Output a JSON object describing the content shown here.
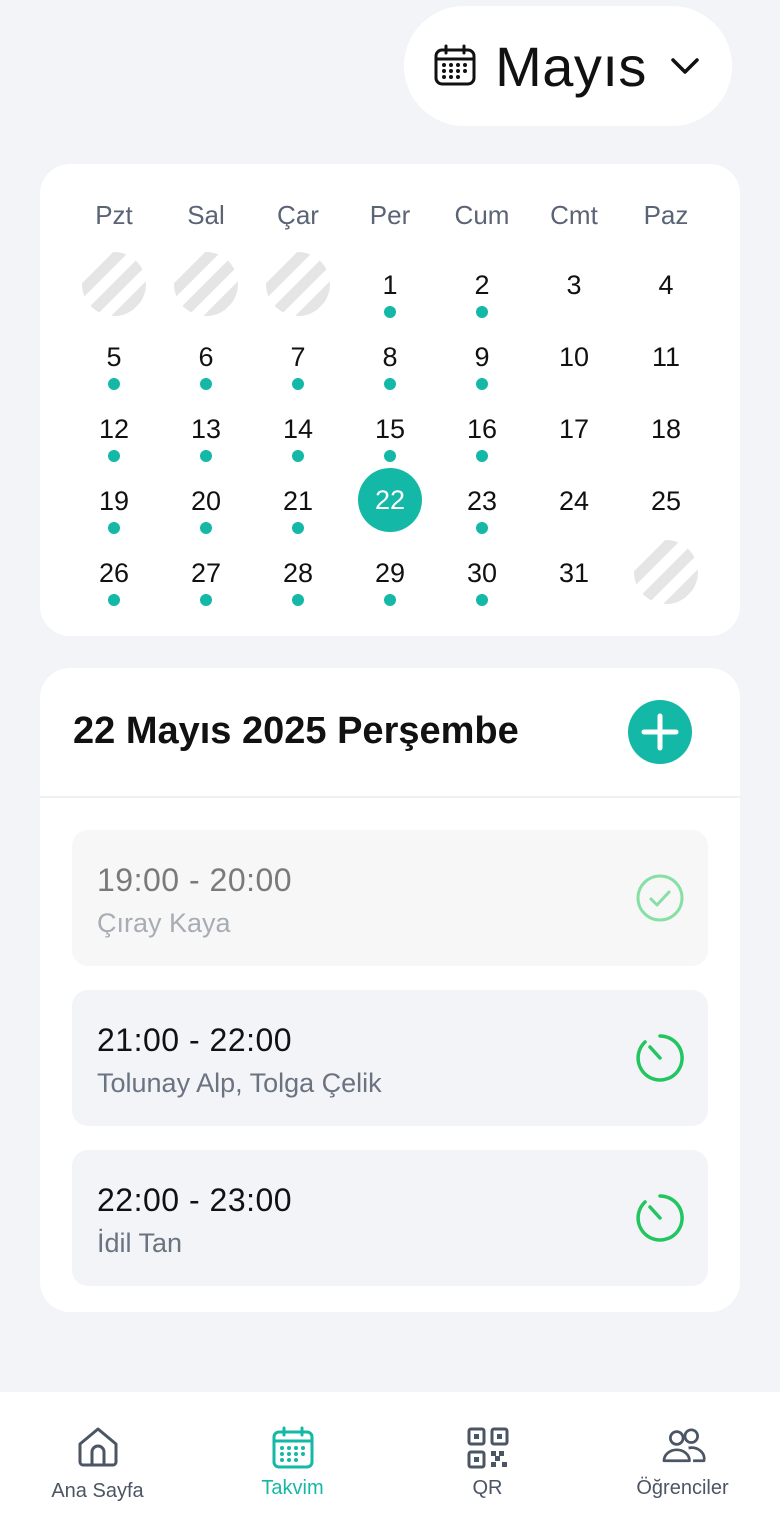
{
  "header": {
    "month": "Mayıs",
    "icon": "calendar-icon",
    "dropdown_icon": "chevron-down-icon"
  },
  "calendar": {
    "weekdays": [
      "Pzt",
      "Sal",
      "Çar",
      "Per",
      "Cum",
      "Cmt",
      "Paz"
    ],
    "weeks": [
      [
        null,
        null,
        null,
        {
          "day": "1",
          "dot": true
        },
        {
          "day": "2",
          "dot": true
        },
        {
          "day": "3",
          "dot": false
        },
        {
          "day": "4",
          "dot": false
        }
      ],
      [
        {
          "day": "5",
          "dot": true
        },
        {
          "day": "6",
          "dot": true
        },
        {
          "day": "7",
          "dot": true
        },
        {
          "day": "8",
          "dot": true
        },
        {
          "day": "9",
          "dot": true
        },
        {
          "day": "10",
          "dot": false
        },
        {
          "day": "11",
          "dot": false
        }
      ],
      [
        {
          "day": "12",
          "dot": true
        },
        {
          "day": "13",
          "dot": true
        },
        {
          "day": "14",
          "dot": true
        },
        {
          "day": "15",
          "dot": true
        },
        {
          "day": "16",
          "dot": true
        },
        {
          "day": "17",
          "dot": false
        },
        {
          "day": "18",
          "dot": false
        }
      ],
      [
        {
          "day": "19",
          "dot": true
        },
        {
          "day": "20",
          "dot": true
        },
        {
          "day": "21",
          "dot": true
        },
        {
          "day": "22",
          "dot": false,
          "selected": true
        },
        {
          "day": "23",
          "dot": true
        },
        {
          "day": "24",
          "dot": false
        },
        {
          "day": "25",
          "dot": false
        }
      ],
      [
        {
          "day": "26",
          "dot": true
        },
        {
          "day": "27",
          "dot": true
        },
        {
          "day": "28",
          "dot": true
        },
        {
          "day": "29",
          "dot": true
        },
        {
          "day": "30",
          "dot": true
        },
        {
          "day": "31",
          "dot": false
        },
        null
      ]
    ],
    "accent_color": "#14b8a6"
  },
  "day_detail": {
    "title": "22 Mayıs 2025 Perşembe",
    "add_icon": "plus-icon",
    "lessons": [
      {
        "time": "19:00 - 20:00",
        "students": "Çıray Kaya",
        "status": "completed",
        "icon": "check-circle-icon"
      },
      {
        "time": "21:00 - 22:00",
        "students": "Tolunay Alp, Tolga Çelik",
        "status": "upcoming",
        "icon": "timer-icon"
      },
      {
        "time": "22:00 - 23:00",
        "students": "İdil Tan",
        "status": "upcoming",
        "icon": "timer-icon"
      }
    ]
  },
  "nav": {
    "items": [
      {
        "label": "Ana Sayfa",
        "icon": "home-icon",
        "active": false
      },
      {
        "label": "Takvim",
        "icon": "calendar-icon",
        "active": true
      },
      {
        "label": "QR",
        "icon": "qr-code-icon",
        "active": false
      },
      {
        "label": "Öğrenciler",
        "icon": "users-icon",
        "active": false
      }
    ]
  }
}
